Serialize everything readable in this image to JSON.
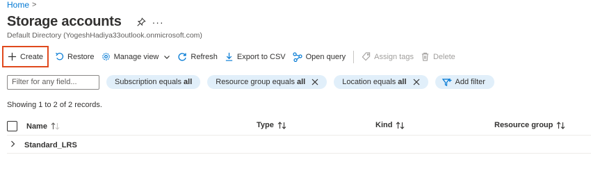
{
  "breadcrumb": {
    "home": "Home",
    "separator": ">"
  },
  "header": {
    "title": "Storage accounts",
    "subtitle": "Default Directory (YogeshHadiya33outlook.onmicrosoft.com)",
    "more": "···"
  },
  "toolbar": {
    "create": "Create",
    "restore": "Restore",
    "manage_view": "Manage view",
    "refresh": "Refresh",
    "export_csv": "Export to CSV",
    "open_query": "Open query",
    "assign_tags": "Assign tags",
    "delete": "Delete"
  },
  "filters": {
    "search_placeholder": "Filter for any field...",
    "subscription": {
      "label": "Subscription equals",
      "value": "all"
    },
    "resource_group": {
      "label": "Resource group equals",
      "value": "all"
    },
    "location": {
      "label": "Location equals",
      "value": "all"
    },
    "add_filter": "Add filter"
  },
  "records_text": "Showing 1 to 2 of 2 records.",
  "grid": {
    "columns": [
      "Name",
      "Type",
      "Kind",
      "Resource group"
    ],
    "groups": [
      {
        "label": "Standard_LRS"
      }
    ]
  },
  "colors": {
    "accent": "#0078d4",
    "highlight_border": "#e0491d",
    "pill_bg": "#e1effa"
  }
}
